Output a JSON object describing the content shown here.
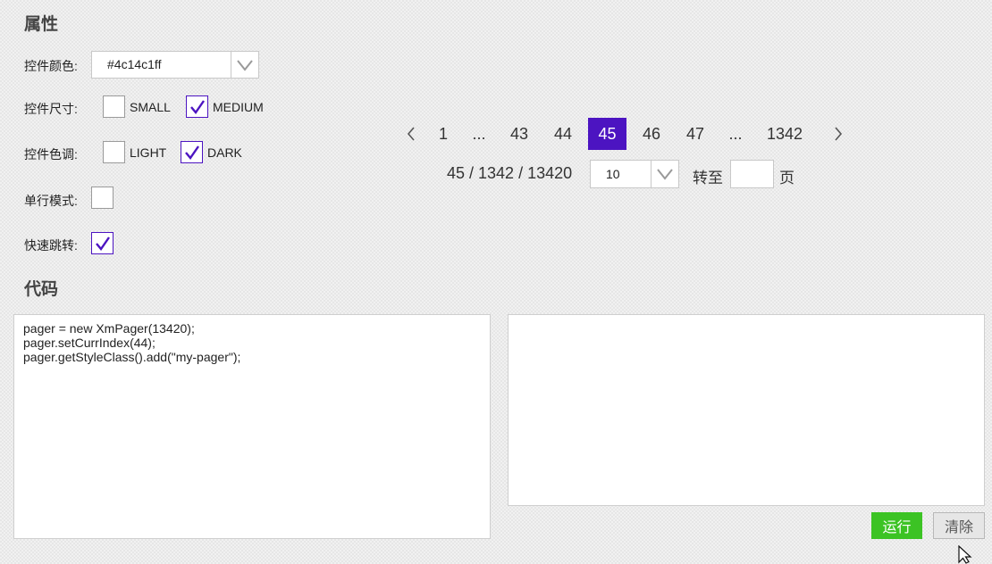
{
  "properties": {
    "title": "属性",
    "color": {
      "label": "控件颜色:",
      "value": "#4c14c1ff"
    },
    "size": {
      "label": "控件尺寸:",
      "options": [
        {
          "label": "SMALL",
          "checked": false
        },
        {
          "label": "MEDIUM",
          "checked": true
        }
      ]
    },
    "tone": {
      "label": "控件色调:",
      "options": [
        {
          "label": "LIGHT",
          "checked": false
        },
        {
          "label": "DARK",
          "checked": true
        }
      ]
    },
    "single_line": {
      "label": "单行模式:",
      "checked": false
    },
    "quick_jump": {
      "label": "快速跳转:",
      "checked": true
    }
  },
  "pager": {
    "prev_icon": "chevron-left-icon",
    "next_icon": "chevron-right-icon",
    "pages": [
      "1",
      "...",
      "43",
      "44",
      "45",
      "46",
      "47",
      "...",
      "1342"
    ],
    "current": "45",
    "info": "45 / 1342 / 13420",
    "page_size": "10",
    "goto_label": "转至",
    "goto_value": "",
    "page_suffix": "页"
  },
  "code": {
    "title": "代码",
    "lines": [
      "pager = new XmPager(13420);",
      "pager.setCurrIndex(44);",
      "pager.getStyleClass().add(\"my-pager\");"
    ],
    "output": "",
    "run_label": "运行",
    "clear_label": "清除"
  },
  "colors": {
    "accent": "#4c14c1",
    "run_button": "#3cc324",
    "clear_button": "#e6e6e6"
  }
}
